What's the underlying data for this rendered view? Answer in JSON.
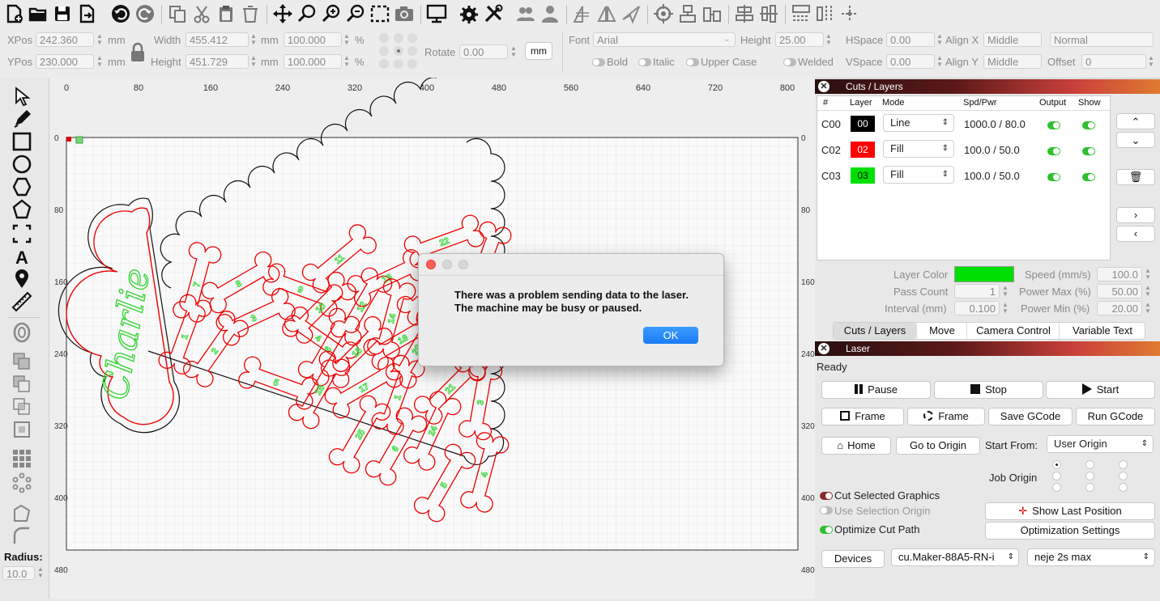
{
  "toolbar": {
    "icons": [
      "new-file-icon",
      "open-folder-icon",
      "save-icon",
      "export-icon",
      "undo-icon",
      "redo-icon",
      "copy-icon",
      "cut-icon",
      "paste-icon",
      "delete-icon",
      "move-icon",
      "zoom-icon",
      "zoom-in-icon",
      "zoom-out-icon",
      "select-rect-icon",
      "camera-icon",
      "monitor-icon",
      "settings-icon",
      "tools-icon",
      "group-icon",
      "user-icon",
      "mirror-h-icon",
      "mirror-v-icon",
      "send-icon",
      "target-icon",
      "align-icon",
      "distribute-icon",
      "align-center-icon",
      "align-middle-icon",
      "dock-icon",
      "split-icon",
      "crosshair-icon"
    ]
  },
  "props": {
    "xpos_label": "XPos",
    "xpos_value": "242.360",
    "ypos_label": "YPos",
    "ypos_value": "230.000",
    "unit_mm": "mm",
    "width_label": "Width",
    "width_value": "455.412",
    "height_label": "Height",
    "height_value": "451.729",
    "scale_w": "100.000",
    "scale_h": "100.000",
    "percent": "%",
    "rotate_label": "Rotate",
    "rotate_value": "0.00",
    "mm_button": "mm",
    "font_label": "Font",
    "font_value": "Arial",
    "fheight_label": "Height",
    "fheight_value": "25.00",
    "hspace_label": "HSpace",
    "hspace_value": "0.00",
    "vspace_label": "VSpace",
    "vspace_value": "0.00",
    "alignx_label": "Align X",
    "alignx_value": "Middle",
    "aligny_label": "Align Y",
    "aligny_value": "Middle",
    "style_value": "Normal",
    "offset_label": "Offset",
    "offset_value": "0",
    "bold": "Bold",
    "italic": "Italic",
    "upper": "Upper Case",
    "welded": "Welded"
  },
  "lefttools": {
    "radius_label": "Radius:",
    "radius_value": "10.0"
  },
  "ruler": {
    "top": [
      "0",
      "80",
      "160",
      "240",
      "320",
      "400",
      "480",
      "560",
      "640",
      "720",
      "800"
    ],
    "left": [
      "0",
      "80",
      "160",
      "240",
      "320",
      "400",
      "480"
    ],
    "right": [
      "0",
      "80",
      "160",
      "240",
      "320",
      "400",
      "480"
    ]
  },
  "design": {
    "name_text": "Charlie",
    "bone_numbers": [
      "1",
      "2",
      "3",
      "4",
      "5",
      "6",
      "7",
      "8",
      "9",
      "10",
      "11",
      "12",
      "13",
      "14",
      "15",
      "16",
      "17",
      "18",
      "19",
      "20",
      "21",
      "22",
      "23",
      "24",
      "25"
    ]
  },
  "cuts": {
    "title": "Cuts / Layers",
    "headers": [
      "#",
      "Layer",
      "Mode",
      "Spd/Pwr",
      "Output",
      "Show"
    ],
    "rows": [
      {
        "id": "C00",
        "layer": "00",
        "color": "#000000",
        "mode": "Line",
        "spdpwr": "1000.0 / 80.0"
      },
      {
        "id": "C02",
        "layer": "02",
        "color": "#ff0000",
        "mode": "Fill",
        "spdpwr": "100.0 / 50.0"
      },
      {
        "id": "C03",
        "layer": "03",
        "color": "#00e000",
        "mode": "Fill",
        "spdpwr": "100.0 / 50.0"
      }
    ],
    "layer_color_label": "Layer Color",
    "layer_color": "#00e000",
    "speed_label": "Speed (mm/s)",
    "speed_value": "100.0",
    "pass_label": "Pass Count",
    "pass_value": "1",
    "powmax_label": "Power Max (%)",
    "powmax_value": "50.00",
    "interval_label": "Interval (mm)",
    "interval_value": "0.100",
    "powmin_label": "Power Min (%)",
    "powmin_value": "20.00",
    "tabs": [
      "Cuts / Layers",
      "Move",
      "Camera Control",
      "Variable Text"
    ]
  },
  "laser": {
    "title": "Laser",
    "status": "Ready",
    "pause": "Pause",
    "stop": "Stop",
    "start": "Start",
    "frame1": "Frame",
    "frame2": "Frame",
    "save_gcode": "Save GCode",
    "run_gcode": "Run GCode",
    "home": "Home",
    "goto_origin": "Go to Origin",
    "start_from_label": "Start From:",
    "start_from_value": "User Origin",
    "job_origin_label": "Job Origin",
    "cut_selected": "Cut Selected Graphics",
    "use_selection_origin": "Use Selection Origin",
    "optimize": "Optimize Cut Path",
    "show_last": "Show Last Position",
    "opt_settings": "Optimization Settings",
    "devices": "Devices",
    "device_value": "cu.Maker-88A5-RN-i",
    "profile_value": "neje 2s max"
  },
  "dialog": {
    "line1": "There was a problem sending data to the laser.",
    "line2": "The machine may be busy or paused.",
    "ok": "OK"
  }
}
